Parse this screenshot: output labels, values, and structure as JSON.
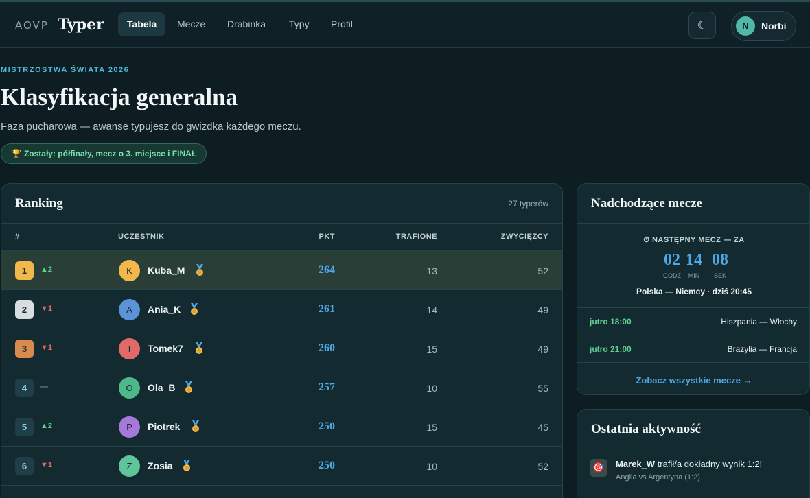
{
  "nav": {
    "brand_mark": "AOVP",
    "brand_name": "Typer",
    "links": [
      "Tabela",
      "Mecze",
      "Drabinka",
      "Typy",
      "Profil"
    ],
    "active": "Tabela",
    "theme_icon": "☾",
    "user_initial": "N",
    "user_name": "Norbi"
  },
  "hero": {
    "eyebrow": "MISTRZOSTWA ŚWIATA 2026",
    "title": "Klasyfikacja generalna",
    "subtitle": "Faza pucharowa — awanse typujesz do gwizdka każdego meczu.",
    "badge": "Zostały: półfinały, mecz o 3. miejsce i FINAŁ"
  },
  "ranking": {
    "title": "Ranking",
    "meta": "27 typerów",
    "columns": [
      "#",
      "UCZESTNIK",
      "PKT",
      "TRAFIONE",
      "ZWYCIĘZCY"
    ],
    "rows": [
      {
        "rank": "1",
        "trend": "▲2",
        "trend_dir": "up",
        "initial": "K",
        "name": "Kuba_M",
        "pts": "264",
        "hits": "13",
        "wins": "52"
      },
      {
        "rank": "2",
        "trend": "▼1",
        "trend_dir": "down",
        "initial": "A",
        "name": "Ania_K",
        "pts": "261",
        "hits": "14",
        "wins": "49"
      },
      {
        "rank": "3",
        "trend": "▼1",
        "trend_dir": "down",
        "initial": "T",
        "name": "Tomek7",
        "pts": "260",
        "hits": "15",
        "wins": "49"
      },
      {
        "rank": "4",
        "trend": "—",
        "trend_dir": "same",
        "initial": "O",
        "name": "Ola_B",
        "pts": "257",
        "hits": "10",
        "wins": "55"
      },
      {
        "rank": "5",
        "trend": "▲2",
        "trend_dir": "up",
        "initial": "P",
        "name": "Piotrek",
        "pts": "250",
        "hits": "15",
        "wins": "45"
      },
      {
        "rank": "6",
        "trend": "▼1",
        "trend_dir": "down",
        "initial": "Z",
        "name": "Zosia",
        "pts": "250",
        "hits": "10",
        "wins": "52"
      }
    ]
  },
  "upcoming": {
    "title": "Nadchodzące mecze",
    "countdown_label": "NASTĘPNY MECZ — ZA",
    "hours": "02",
    "minutes": "14",
    "seconds": "08",
    "unit_h": "GODZ",
    "unit_m": "MIN",
    "unit_s": "SEK",
    "next_match": "Polska — Niemcy · dziś 20:45",
    "matches": [
      {
        "time": "jutro 18:00",
        "teams": "Hiszpania — Włochy"
      },
      {
        "time": "jutro 21:00",
        "teams": "Brazylia — Francja"
      }
    ],
    "all_link": "Zobacz wszystkie mecze →"
  },
  "activity": {
    "title": "Ostatnia aktywność",
    "user": "Marek_W",
    "action": " trafił/a dokładny wynik 1:2!",
    "detail": "Anglia vs Argentyna (1:2)"
  },
  "colors": {
    "rank1": "#f2b84b",
    "rank2": "#d8dde0",
    "rank3": "#d98a4f",
    "rank_other": "#1f3e47",
    "avatars": [
      "#f2b84b",
      "#5b93d9",
      "#e06a6a",
      "#4fb88a",
      "#a678d9",
      "#5fc49a"
    ]
  }
}
